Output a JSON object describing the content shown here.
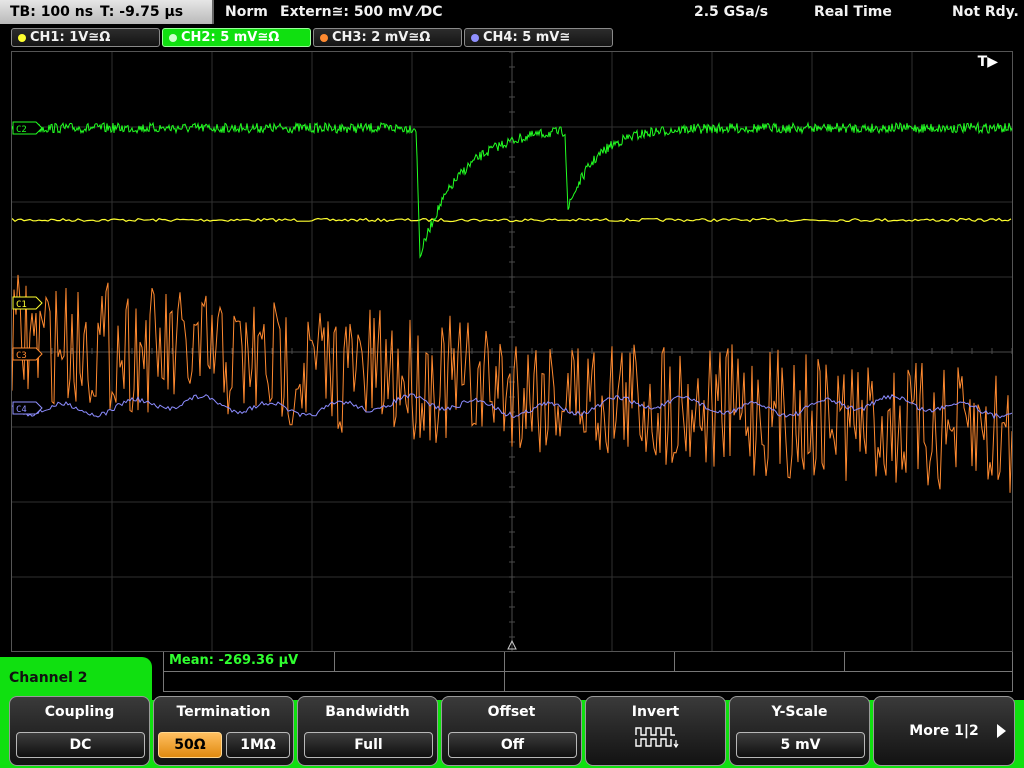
{
  "status_bar": {
    "timebase": "TB: 100 ns",
    "trigger_time": "T: -9.75 µs",
    "trigger_mode": "Norm",
    "trigger_source": "Extern≅: 500 mV ⁄DC",
    "sample_rate": "2.5 GSa/s",
    "acq_mode": "Real Time",
    "state": "Not Rdy."
  },
  "channels": [
    {
      "label": "CH1: 1V≅Ω",
      "color": "#ffff30",
      "active": false
    },
    {
      "label": "CH2: 5 mV≅Ω",
      "color": "#22ff22",
      "active": true
    },
    {
      "label": "CH3: 2 mV≅Ω",
      "color": "#ff8a30",
      "active": false
    },
    {
      "label": "CH4: 5 mV≅",
      "color": "#9090ff",
      "active": false
    }
  ],
  "display": {
    "trigger_indicator": "T▶",
    "markers": [
      "C2",
      "C1",
      "C3",
      "C4"
    ]
  },
  "measurement": {
    "mean": "Mean: -269.36 µV"
  },
  "menu": {
    "title": "Channel 2",
    "coupling": {
      "title": "Coupling",
      "value": "DC"
    },
    "termination": {
      "title": "Termination",
      "options": [
        "50Ω",
        "1MΩ"
      ],
      "selected": "50Ω"
    },
    "bandwidth": {
      "title": "Bandwidth",
      "value": "Full"
    },
    "offset": {
      "title": "Offset",
      "value": "Off"
    },
    "invert": {
      "title": "Invert"
    },
    "yscale": {
      "title": "Y-Scale",
      "value": "5 mV"
    },
    "more": {
      "label": "More 1|2"
    }
  },
  "icons": {
    "trigger_tag": "trigger-arrow-icon",
    "invert": "invert-waveform-icon",
    "more": "arrow-right-icon"
  }
}
